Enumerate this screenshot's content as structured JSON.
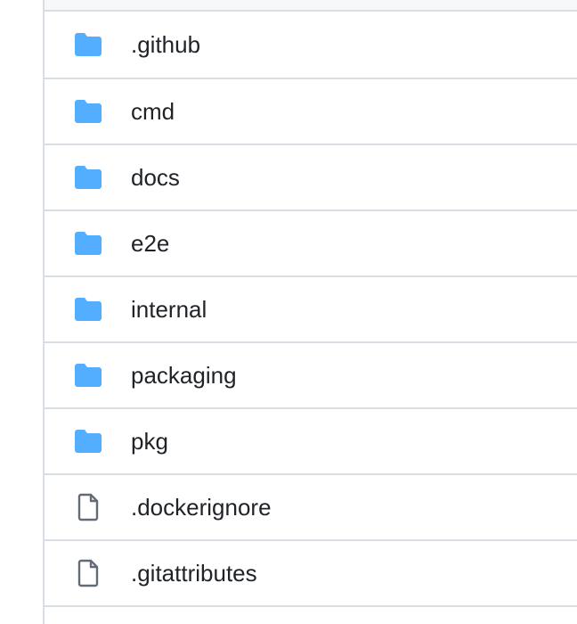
{
  "colors": {
    "folder": "#54aeff",
    "file_icon": "#636c76",
    "text": "#1f2328",
    "border": "#d8dee4",
    "header_bg": "#f6f8fa"
  },
  "files": [
    {
      "name": ".github",
      "type": "directory",
      "icon": "folder-icon"
    },
    {
      "name": "cmd",
      "type": "directory",
      "icon": "folder-icon"
    },
    {
      "name": "docs",
      "type": "directory",
      "icon": "folder-icon"
    },
    {
      "name": "e2e",
      "type": "directory",
      "icon": "folder-icon"
    },
    {
      "name": "internal",
      "type": "directory",
      "icon": "folder-icon"
    },
    {
      "name": "packaging",
      "type": "directory",
      "icon": "folder-icon"
    },
    {
      "name": "pkg",
      "type": "directory",
      "icon": "folder-icon"
    },
    {
      "name": ".dockerignore",
      "type": "file",
      "icon": "file-icon"
    },
    {
      "name": ".gitattributes",
      "type": "file",
      "icon": "file-icon"
    }
  ]
}
